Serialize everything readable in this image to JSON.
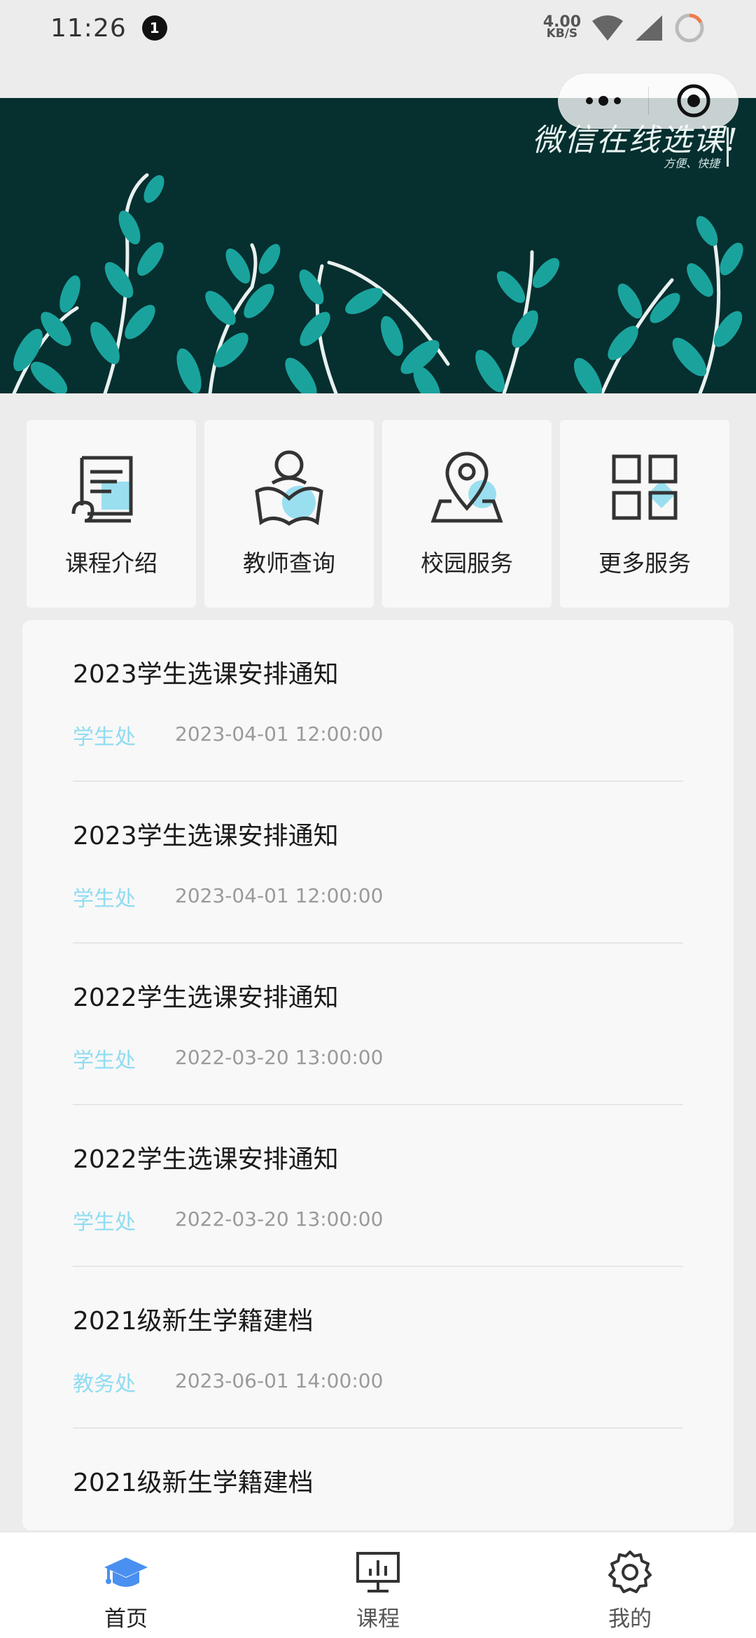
{
  "status_bar": {
    "time": "11:26",
    "notification_count": "1",
    "net_speed_value": "4.00",
    "net_speed_unit": "KB/S"
  },
  "banner": {
    "title": "微信在线选课!",
    "subtitle": "方便、快捷",
    "slide_count": 3,
    "active_slide": 3
  },
  "services": [
    {
      "label": "课程介绍",
      "icon": "course-doc-icon"
    },
    {
      "label": "教师查询",
      "icon": "teacher-book-icon"
    },
    {
      "label": "校园服务",
      "icon": "location-pin-icon"
    },
    {
      "label": "更多服务",
      "icon": "grid-apps-icon"
    }
  ],
  "notices": [
    {
      "title": "2023学生选课安排通知",
      "dept": "学生处",
      "time": "2023-04-01 12:00:00"
    },
    {
      "title": "2023学生选课安排通知",
      "dept": "学生处",
      "time": "2023-04-01 12:00:00"
    },
    {
      "title": "2022学生选课安排通知",
      "dept": "学生处",
      "time": "2022-03-20 13:00:00"
    },
    {
      "title": "2022学生选课安排通知",
      "dept": "学生处",
      "time": "2022-03-20 13:00:00"
    },
    {
      "title": "2021级新生学籍建档",
      "dept": "教务处",
      "time": "2023-06-01 14:00:00"
    },
    {
      "title": "2021级新生学籍建档",
      "dept": "",
      "time": ""
    }
  ],
  "tabs": [
    {
      "label": "首页",
      "icon": "graduation-cap-icon",
      "active": true
    },
    {
      "label": "课程",
      "icon": "presentation-board-icon",
      "active": false
    },
    {
      "label": "我的",
      "icon": "gear-icon",
      "active": false
    }
  ],
  "colors": {
    "accent_blue": "#4a90f0",
    "dept_text": "#8fdcf2",
    "icon_accent": "#9adff0",
    "banner_bg": "#062f2f",
    "leaf": "#1aa39d"
  }
}
